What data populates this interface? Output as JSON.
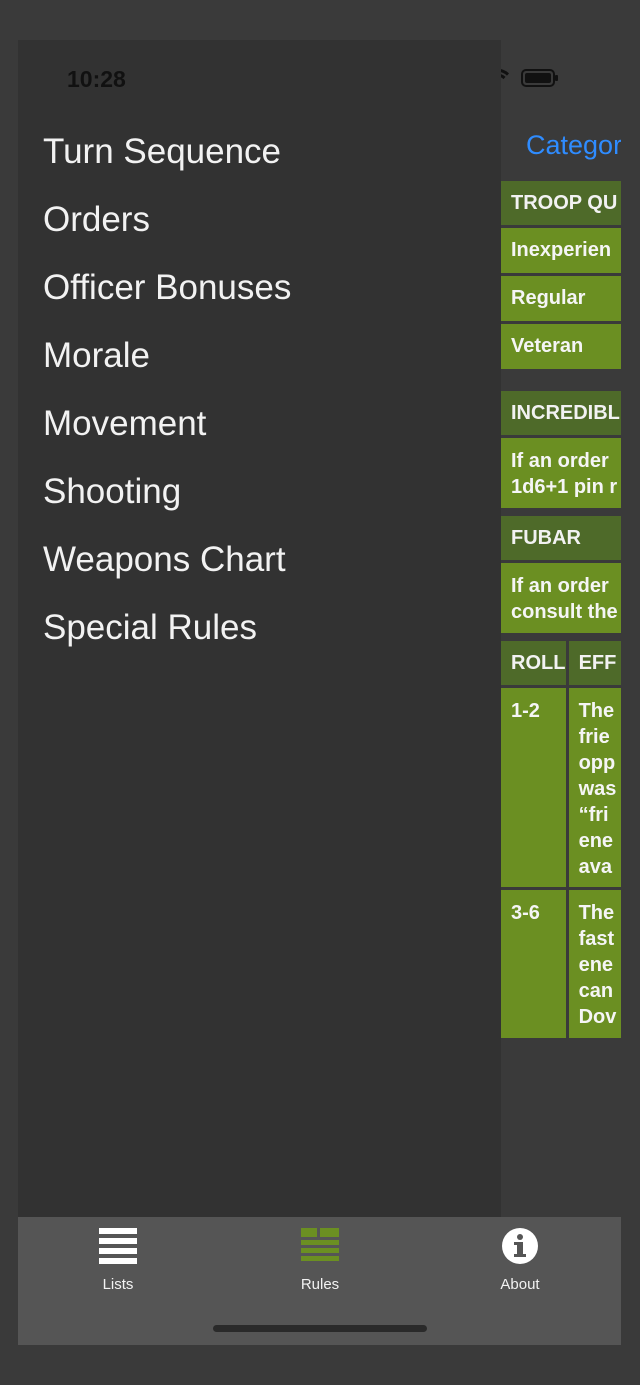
{
  "status": {
    "time": "10:28"
  },
  "content": {
    "category_link": "Categor",
    "troop_quality": {
      "header": "TROOP QU",
      "rows": [
        "Inexperien",
        "Regular",
        "Veteran"
      ]
    },
    "incredible": {
      "header": "INCREDIBL",
      "text": "If an order\n1d6+1 pin r"
    },
    "fubar": {
      "header": "FUBAR",
      "text": "If an order\nconsult the"
    },
    "roll_table": {
      "headers": [
        "ROLL",
        "EFF"
      ],
      "rows": [
        {
          "roll": "1-2",
          "effect": "The\nfrie\nopp\nwas\n“fri\nene\nava"
        },
        {
          "roll": "3-6",
          "effect": "The\nfast\nene\ncan\nDov"
        }
      ]
    }
  },
  "menu": {
    "items": [
      "Turn Sequence",
      "Orders",
      "Officer Bonuses",
      "Morale",
      "Movement",
      "Shooting",
      "Weapons Chart",
      "Special Rules"
    ]
  },
  "tabbar": {
    "tabs": [
      {
        "label": "Lists",
        "icon": "list-icon"
      },
      {
        "label": "Rules",
        "icon": "rules-icon",
        "active": true
      },
      {
        "label": "About",
        "icon": "info-icon"
      }
    ],
    "active_color": "#6b8f22"
  }
}
